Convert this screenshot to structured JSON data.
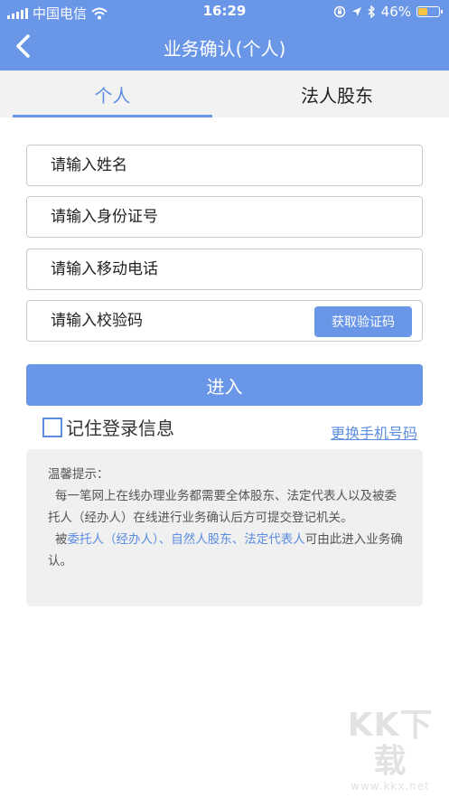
{
  "status_bar": {
    "carrier": "中国电信",
    "time": "16:29",
    "battery": "46%",
    "battery_level": 0.46
  },
  "nav": {
    "title": "业务确认(个人)"
  },
  "tabs": [
    {
      "label": "个人",
      "active": true
    },
    {
      "label": "法人股东",
      "active": false
    }
  ],
  "form": {
    "name_placeholder": "请输入姓名",
    "id_placeholder": "请输入身份证号",
    "phone_placeholder": "请输入移动电话",
    "code_placeholder": "请输入校验码",
    "get_code_label": "获取验证码",
    "submit_label": "进入",
    "remember_label": "记住登录信息",
    "change_phone_label": "更换手机号码"
  },
  "tips": {
    "heading": "温馨提示：",
    "line1": "每一笔网上在线办理业务都需要全体股东、法定代表人以及被委托人（经办人）在线进行业务确认后方可提交登记机关。",
    "line2_prefix": "被",
    "line2_link": "委托人（经办人）、自然人股东、法定代表人",
    "line2_suffix": "可由此进入业务确认。"
  },
  "watermark": {
    "logo": "KK下载",
    "url": "www.kkx.net"
  },
  "colors": {
    "primary": "#6a96e8",
    "link": "#5b8de0",
    "battery_fill": "#f6c443",
    "tips_bg": "#f0f0f0"
  }
}
